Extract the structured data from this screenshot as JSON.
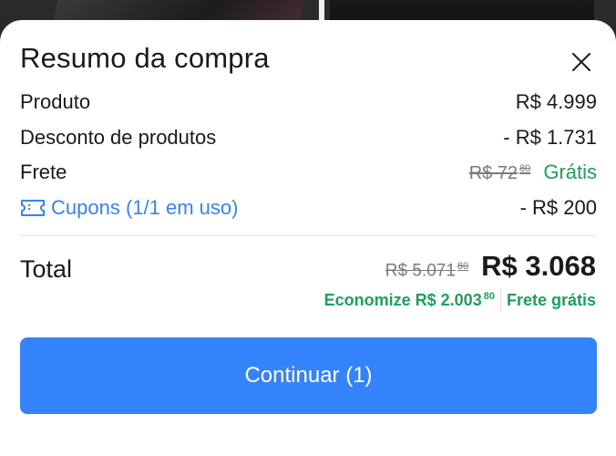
{
  "modal": {
    "title": "Resumo da compra"
  },
  "rows": {
    "produto": {
      "label": "Produto",
      "value": "R$ 4.999"
    },
    "desconto": {
      "label": "Desconto de produtos",
      "value": "- R$ 1.731"
    },
    "frete": {
      "label": "Frete",
      "old_price": "R$ 72",
      "old_cents": "80",
      "value": "Grátis"
    },
    "cupons": {
      "label": "Cupons (1/1 em uso)",
      "value": "- R$ 200"
    }
  },
  "total": {
    "label": "Total",
    "old_price": "R$ 5.071",
    "old_cents": "80",
    "value": "R$ 3.068",
    "savings_text": "Economize R$ 2.003",
    "savings_cents": "80",
    "shipping_note": "Frete grátis"
  },
  "cta": {
    "label": "Continuar (1)"
  },
  "colors": {
    "accent_blue": "#3483fa",
    "discount_green": "#1aa15a",
    "text_primary": "#1a1a1a",
    "text_muted": "#7a7a7a"
  },
  "icons": {
    "close": "close-icon",
    "coupon": "ticket-icon"
  }
}
